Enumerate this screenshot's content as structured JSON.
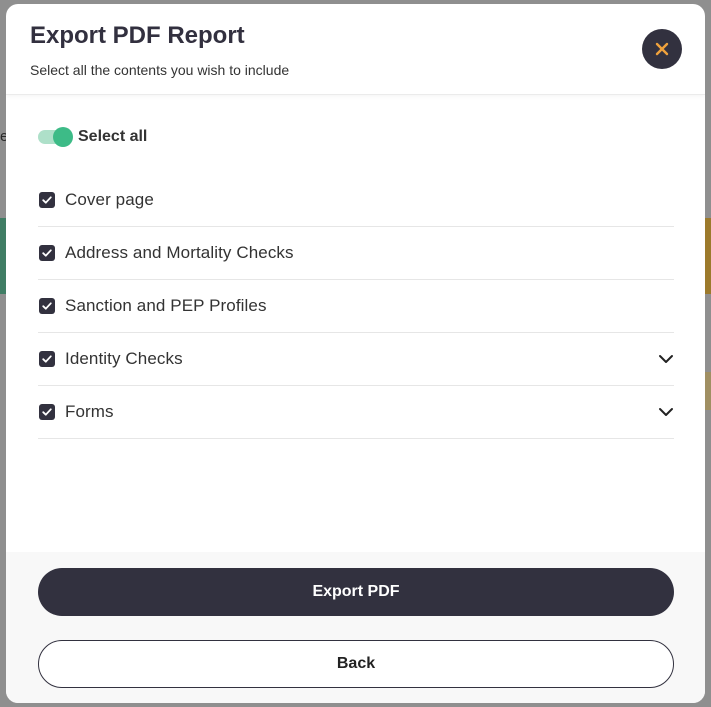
{
  "background": {
    "partial_text": "e"
  },
  "modal": {
    "title": "Export PDF Report",
    "subtitle": "Select all the contents you wish to include",
    "close_icon": "close-icon",
    "select_all": {
      "label": "Select all",
      "enabled": true
    },
    "items": [
      {
        "label": "Cover page",
        "checked": true,
        "expandable": false
      },
      {
        "label": "Address and Mortality Checks",
        "checked": true,
        "expandable": false
      },
      {
        "label": "Sanction and PEP Profiles",
        "checked": true,
        "expandable": false
      },
      {
        "label": "Identity Checks",
        "checked": true,
        "expandable": true
      },
      {
        "label": "Forms",
        "checked": true,
        "expandable": true
      }
    ],
    "buttons": {
      "export_label": "Export PDF",
      "back_label": "Back"
    }
  },
  "colors": {
    "primary_dark": "#32313f",
    "accent_orange": "#f0a23c",
    "toggle_green": "#3dbb87"
  }
}
